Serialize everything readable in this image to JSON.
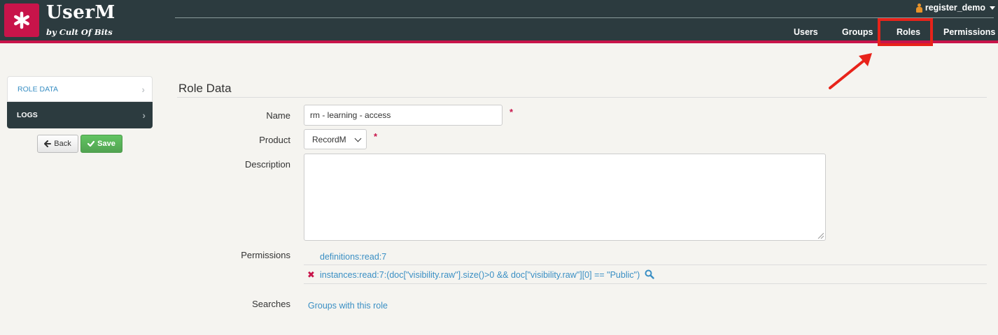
{
  "app": {
    "title": "UserM",
    "subtitle": "by Cult Of Bits",
    "logo_icon": "asterisk-icon",
    "brand_color": "#c8144a",
    "header_color": "#2c3b3f"
  },
  "user_menu": {
    "username": "register_demo",
    "icon": "user-icon"
  },
  "nav": {
    "users": "Users",
    "groups": "Groups",
    "roles": "Roles",
    "permissions": "Permissions",
    "highlighted": "Roles"
  },
  "sidebar": {
    "items": [
      {
        "label": "ROLE DATA",
        "active": false
      },
      {
        "label": "LOGS",
        "active": true
      }
    ],
    "back_label": "Back",
    "save_label": "Save"
  },
  "form": {
    "section_title": "Role Data",
    "name_label": "Name",
    "name_value": "rm - learning - access",
    "product_label": "Product",
    "product_value": "RecordM",
    "description_label": "Description",
    "description_value": "",
    "permissions_label": "Permissions",
    "permissions": [
      {
        "text": "definitions:read:7",
        "removable": false
      },
      {
        "text": "instances:read:7:(doc[\"visibility.raw\"].size()>0 && doc[\"visibility.raw\"][0] == \"Public\")",
        "removable": true
      }
    ],
    "searches_label": "Searches",
    "searches_link": "Groups with this role",
    "required_marker": "*"
  }
}
